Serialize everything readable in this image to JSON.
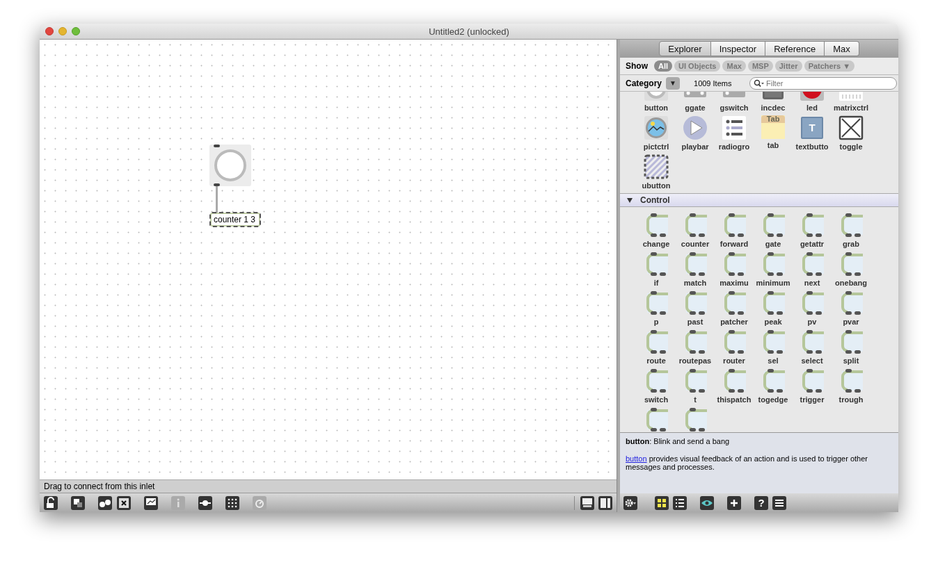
{
  "window": {
    "title": "Untitled2 (unlocked)"
  },
  "patcher": {
    "objects": [
      {
        "kind": "button"
      },
      {
        "kind": "object",
        "text": "counter 1 3"
      }
    ],
    "status": "Drag to connect from this inlet",
    "toolbar": [
      {
        "kind": "lock",
        "disabled": false
      },
      {
        "kind": "squares",
        "disabled": false
      },
      {
        "kind": "binoculars",
        "disabled": false
      },
      {
        "kind": "close",
        "disabled": false
      },
      {
        "kind": "easel",
        "disabled": false
      },
      {
        "kind": "info",
        "disabled": true
      },
      {
        "kind": "slider",
        "disabled": false
      },
      {
        "kind": "grid",
        "disabled": false
      },
      {
        "kind": "dial",
        "disabled": true
      }
    ],
    "view_buttons": [
      {
        "kind": "bottom-panel"
      },
      {
        "kind": "side-panel"
      }
    ]
  },
  "sidebar": {
    "tabs": [
      {
        "label": "Explorer",
        "selected": true
      },
      {
        "label": "Inspector",
        "selected": false
      },
      {
        "label": "Reference",
        "selected": false
      },
      {
        "label": "Max",
        "selected": false
      }
    ],
    "show_label": "Show",
    "filters": [
      {
        "label": "All",
        "selected": true
      },
      {
        "label": "UI Objects",
        "selected": false
      },
      {
        "label": "Max",
        "selected": false
      },
      {
        "label": "MSP",
        "selected": false
      },
      {
        "label": "Jitter",
        "selected": false
      },
      {
        "label": "Patchers ▼",
        "selected": false
      }
    ],
    "category_label": "Category",
    "category_button": "▼",
    "count": "1009 Items",
    "filter_placeholder": "Filter",
    "ui_items": [
      {
        "kind": "button",
        "label": "button"
      },
      {
        "kind": "ggate",
        "label": "ggate"
      },
      {
        "kind": "gswitch",
        "label": "gswitch"
      },
      {
        "kind": "incdec",
        "label": "incdec"
      },
      {
        "kind": "led",
        "label": "led"
      },
      {
        "kind": "matrixctrl",
        "label": "matrixctrl"
      },
      {
        "kind": "pictctrl",
        "label": "pictctrl"
      },
      {
        "kind": "playbar",
        "label": "playbar"
      },
      {
        "kind": "radiogroup",
        "label": "radiogro"
      },
      {
        "kind": "tab",
        "label": "tab",
        "icon_text": "Tab"
      },
      {
        "kind": "textbutton",
        "label": "textbutto",
        "icon_text": "T"
      },
      {
        "kind": "toggle",
        "label": "toggle"
      },
      {
        "kind": "ubutton",
        "label": "ubutton"
      }
    ],
    "section": {
      "title": "Control",
      "expanded": true
    },
    "control_items": [
      {
        "kind": "object",
        "label": "change"
      },
      {
        "kind": "object",
        "label": "counter"
      },
      {
        "kind": "object",
        "label": "forward"
      },
      {
        "kind": "object",
        "label": "gate"
      },
      {
        "kind": "object",
        "label": "getattr"
      },
      {
        "kind": "object",
        "label": "grab"
      },
      {
        "kind": "object",
        "label": "if"
      },
      {
        "kind": "object",
        "label": "match"
      },
      {
        "kind": "object",
        "label": "maximu"
      },
      {
        "kind": "object",
        "label": "minimum"
      },
      {
        "kind": "object",
        "label": "next"
      },
      {
        "kind": "object",
        "label": "onebang"
      },
      {
        "kind": "object",
        "label": "p"
      },
      {
        "kind": "object",
        "label": "past"
      },
      {
        "kind": "object",
        "label": "patcher"
      },
      {
        "kind": "object",
        "label": "peak"
      },
      {
        "kind": "object",
        "label": "pv"
      },
      {
        "kind": "object",
        "label": "pvar"
      },
      {
        "kind": "object",
        "label": "route"
      },
      {
        "kind": "object",
        "label": "routepas"
      },
      {
        "kind": "object",
        "label": "router"
      },
      {
        "kind": "object",
        "label": "sel"
      },
      {
        "kind": "object",
        "label": "select"
      },
      {
        "kind": "object",
        "label": "split"
      },
      {
        "kind": "object",
        "label": "switch"
      },
      {
        "kind": "object",
        "label": "t"
      },
      {
        "kind": "object",
        "label": "thispatch"
      },
      {
        "kind": "object",
        "label": "togedge"
      },
      {
        "kind": "object",
        "label": "trigger"
      },
      {
        "kind": "object",
        "label": "trough"
      },
      {
        "kind": "object"
      },
      {
        "kind": "object"
      }
    ],
    "description": {
      "summary": "**button**: Blink and send a bang",
      "link": "button",
      "body": "provides visual feedback of an action and is used to trigger other messages and processes."
    },
    "toolbar": [
      {
        "kind": "gear"
      },
      {
        "kind": "grid",
        "selected": true
      },
      {
        "kind": "list",
        "selected": false
      },
      {
        "kind": "eye"
      },
      {
        "kind": "plus"
      },
      {
        "kind": "help",
        "label": "?"
      },
      {
        "kind": "menu"
      }
    ]
  }
}
